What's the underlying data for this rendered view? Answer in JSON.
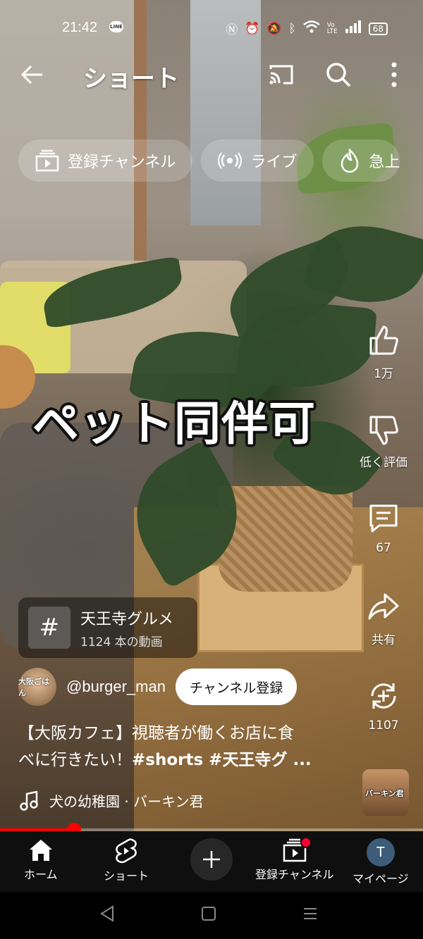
{
  "status_bar": {
    "time": "21:42",
    "line_app": "LINE",
    "battery": "68"
  },
  "header": {
    "title": "ショート"
  },
  "chips": [
    {
      "label": "登録チャンネル",
      "icon": "subscriptions-icon"
    },
    {
      "label": "ライブ",
      "icon": "live-icon"
    },
    {
      "label": "急上",
      "icon": "trending-icon"
    }
  ],
  "video": {
    "overlay_text": "ペット同伴可"
  },
  "actions": {
    "like_count": "1万",
    "dislike_label": "低く評価",
    "comment_count": "67",
    "share_label": "共有",
    "remix_count": "1107"
  },
  "hashtag": {
    "symbol": "#",
    "title": "天王寺グルメ",
    "subtitle": "1124 本の動画"
  },
  "channel": {
    "avatar_text": "大阪ごはん",
    "name": "@burger_man",
    "subscribe_label": "チャンネル登録"
  },
  "description": {
    "line1": "【大阪カフェ】視聴者が働くお店に食",
    "line2_prefix": "べに行きたい！",
    "line2_tags": "#shorts #天王寺グ ..."
  },
  "music": {
    "track": "犬の幼稚園 · バーキン君",
    "thumb_label": "バーキン君"
  },
  "progress": {
    "fraction": 0.175
  },
  "bottom_nav": {
    "home": "ホーム",
    "shorts": "ショート",
    "subscriptions": "登録チャンネル",
    "my_page": "マイページ",
    "my_avatar_letter": "T"
  },
  "colors": {
    "accent": "#ff0000",
    "nav_bg": "#0f0f0f"
  }
}
